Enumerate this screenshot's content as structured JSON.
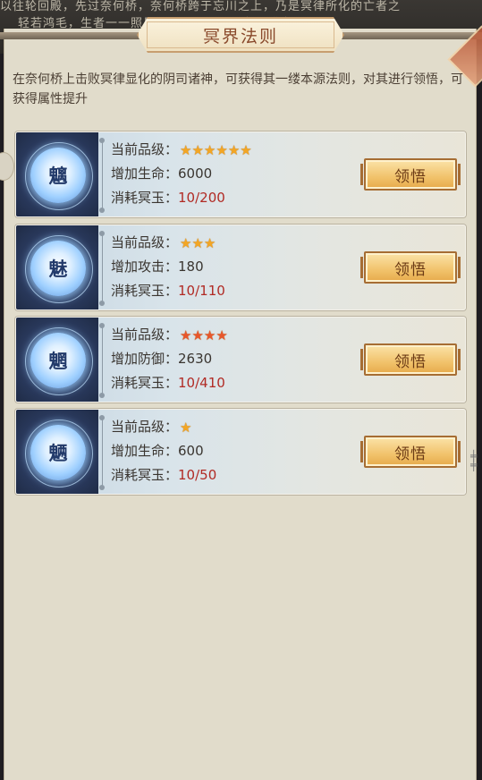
{
  "background_text": {
    "line1": "以往轮回殿，先过奈何桥，奈何桥跨于忘川之上，乃是冥律所化的亡者之",
    "line2": "轻若鸿毛，生者一一照见，……尽业火焚化，唯有"
  },
  "title": "冥界法则",
  "description": "在奈何桥上击败冥律显化的阴司诸神，可获得其一缕本源法则，对其进行领悟，可获得属性提升",
  "labels": {
    "grade": "当前品级：",
    "cost": "消耗冥玉："
  },
  "cards": [
    {
      "char": "魑",
      "stars": 6,
      "star_color": "#f3a624",
      "stat_label": "增加生命：",
      "stat_value": "6000",
      "cost": "10/200",
      "button": "领悟"
    },
    {
      "char": "魅",
      "stars": 3,
      "star_color": "#f3a624",
      "stat_label": "增加攻击：",
      "stat_value": "180",
      "cost": "10/110",
      "button": "领悟"
    },
    {
      "char": "魍",
      "stars": 4,
      "star_color": "#e8562b",
      "stat_label": "增加防御：",
      "stat_value": "2630",
      "cost": "10/410",
      "button": "领悟"
    },
    {
      "char": "魉",
      "stars": 1,
      "star_color": "#f3a624",
      "stat_label": "增加生命：",
      "stat_value": "600",
      "cost": "10/50",
      "button": "领悟"
    }
  ]
}
